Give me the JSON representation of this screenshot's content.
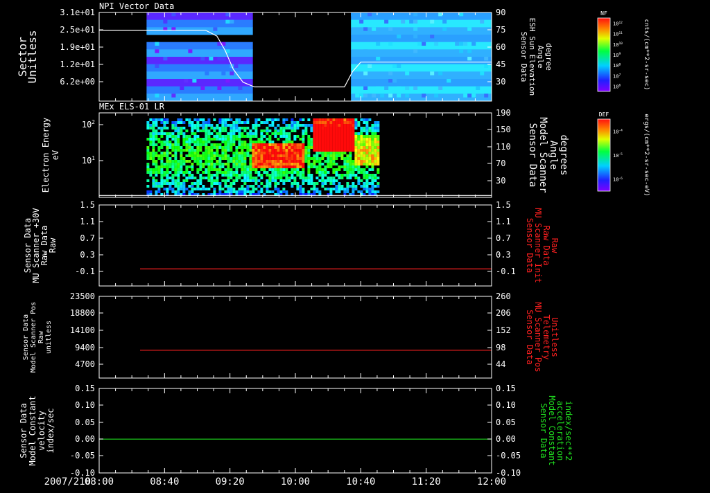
{
  "colors": {
    "background": "#000000",
    "axis": "#ffffff",
    "red_trace": "#ff2020",
    "green_trace": "#20e020",
    "white_trace": "#ffffff"
  },
  "time_axis": {
    "date_label": "2007/210",
    "ticks": [
      "08:00",
      "08:40",
      "09:20",
      "10:00",
      "10:40",
      "11:20",
      "12:00"
    ]
  },
  "chart_data": [
    {
      "id": "panel1",
      "type": "heatmap",
      "title": "NPI Vector Data",
      "ylabel_left": [
        "Sector",
        "Unitless"
      ],
      "yticks_left": [
        "3.1e+01",
        "2.5e+01",
        "1.9e+01",
        "1.2e+01",
        "6.2e+00"
      ],
      "ylabel_right": [
        "Sensor Data",
        "ESH Sun Elevation",
        "Angle",
        "degree"
      ],
      "yticks_right": [
        "90",
        "75",
        "60",
        "45",
        "30"
      ],
      "ylim_right": [
        15,
        90
      ],
      "colorbar": {
        "label": "NF",
        "units": "cnts/(cm**2-sr-sec)",
        "ticks": [
          "10^12",
          "10^11",
          "10^10",
          "10^9",
          "10^8",
          "10^7",
          "10^6"
        ]
      },
      "overlay_line": {
        "name": "ESH Sun Elevation Angle",
        "x": [
          "08:00",
          "09:05",
          "09:12",
          "09:17",
          "09:22",
          "09:28",
          "09:35",
          "10:30",
          "10:35",
          "10:40",
          "12:00"
        ],
        "y": [
          75,
          75,
          70,
          58,
          42,
          31,
          27,
          27,
          40,
          48,
          48
        ]
      },
      "data_segments": [
        [
          "08:29",
          "09:34"
        ],
        [
          "10:34",
          "12:00"
        ]
      ]
    },
    {
      "id": "panel2",
      "type": "heatmap",
      "title": "MEx ELS-01 LR",
      "ylabel_left": [
        "Electron Energy",
        "eV"
      ],
      "yticks_left": [
        "10^2",
        "10^1"
      ],
      "ylabel_right": [
        "Sensor Data",
        "Model Scanner",
        "Angle",
        "degrees"
      ],
      "yticks_right": [
        "190",
        "150",
        "110",
        "70",
        "30"
      ],
      "ylim_right": [
        10,
        190
      ],
      "colorbar": {
        "label": "DEF",
        "units": "ergs/(cm**2-sr-sec-eV)",
        "ticks": [
          "10^-4",
          "10^-5",
          "10^-6"
        ]
      },
      "overlay_line": {
        "name": "Model Scanner Angle",
        "x": [
          "08:00",
          "12:00"
        ],
        "y": [
          14,
          14
        ]
      },
      "data_segments": [
        [
          "08:29",
          "10:51"
        ]
      ]
    },
    {
      "id": "panel3",
      "type": "line",
      "ylabel_left": [
        "Sensor Data",
        "MU Scanner +30V",
        "Raw Data",
        "Raw"
      ],
      "yticks_left": [
        "1.5",
        "1.1",
        "0.7",
        "0.3",
        "-0.1"
      ],
      "ylabel_right": [
        "Sensor Data",
        "MU Scanner Init",
        "Raw Data",
        "Raw"
      ],
      "yticks_right": [
        "1.5",
        "1.1",
        "0.7",
        "0.3",
        "-0.1"
      ],
      "ylim": [
        -0.4,
        1.5
      ],
      "series": [
        {
          "x": [
            "08:25",
            "12:00"
          ],
          "y": [
            0.0,
            0.0
          ]
        }
      ]
    },
    {
      "id": "panel4",
      "type": "line",
      "ylabel_left": [
        "Sensor Data",
        "Model Scanner Pos",
        "Raw",
        "unitless"
      ],
      "yticks_left": [
        "23500",
        "18800",
        "14100",
        "9400",
        "4700"
      ],
      "ylabel_right": [
        "Sensor Data",
        "MU Scanner Pos",
        "Telemetry",
        "Unitless"
      ],
      "yticks_right": [
        "260",
        "206",
        "152",
        "98",
        "44"
      ],
      "ylim": [
        0,
        23500
      ],
      "series": [
        {
          "x": [
            "08:25",
            "12:00"
          ],
          "y": [
            8000,
            8000
          ]
        }
      ]
    },
    {
      "id": "panel5",
      "type": "line",
      "ylabel_left": [
        "Sensor Data",
        "Model Constant",
        "velocity",
        "index/sec"
      ],
      "yticks_left": [
        "0.15",
        "0.10",
        "0.05",
        "0.00",
        "-0.05",
        "-0.10"
      ],
      "ylabel_right": [
        "Sensor Data",
        "Model Constant",
        "acceleration",
        "index/sec**2"
      ],
      "yticks_right": [
        "0.15",
        "0.10",
        "0.05",
        "0.00",
        "-0.05",
        "-0.10"
      ],
      "ylim": [
        -0.1,
        0.15
      ],
      "series": [
        {
          "x": [
            "08:00",
            "12:00"
          ],
          "y": [
            0.0,
            0.0
          ]
        }
      ]
    }
  ]
}
